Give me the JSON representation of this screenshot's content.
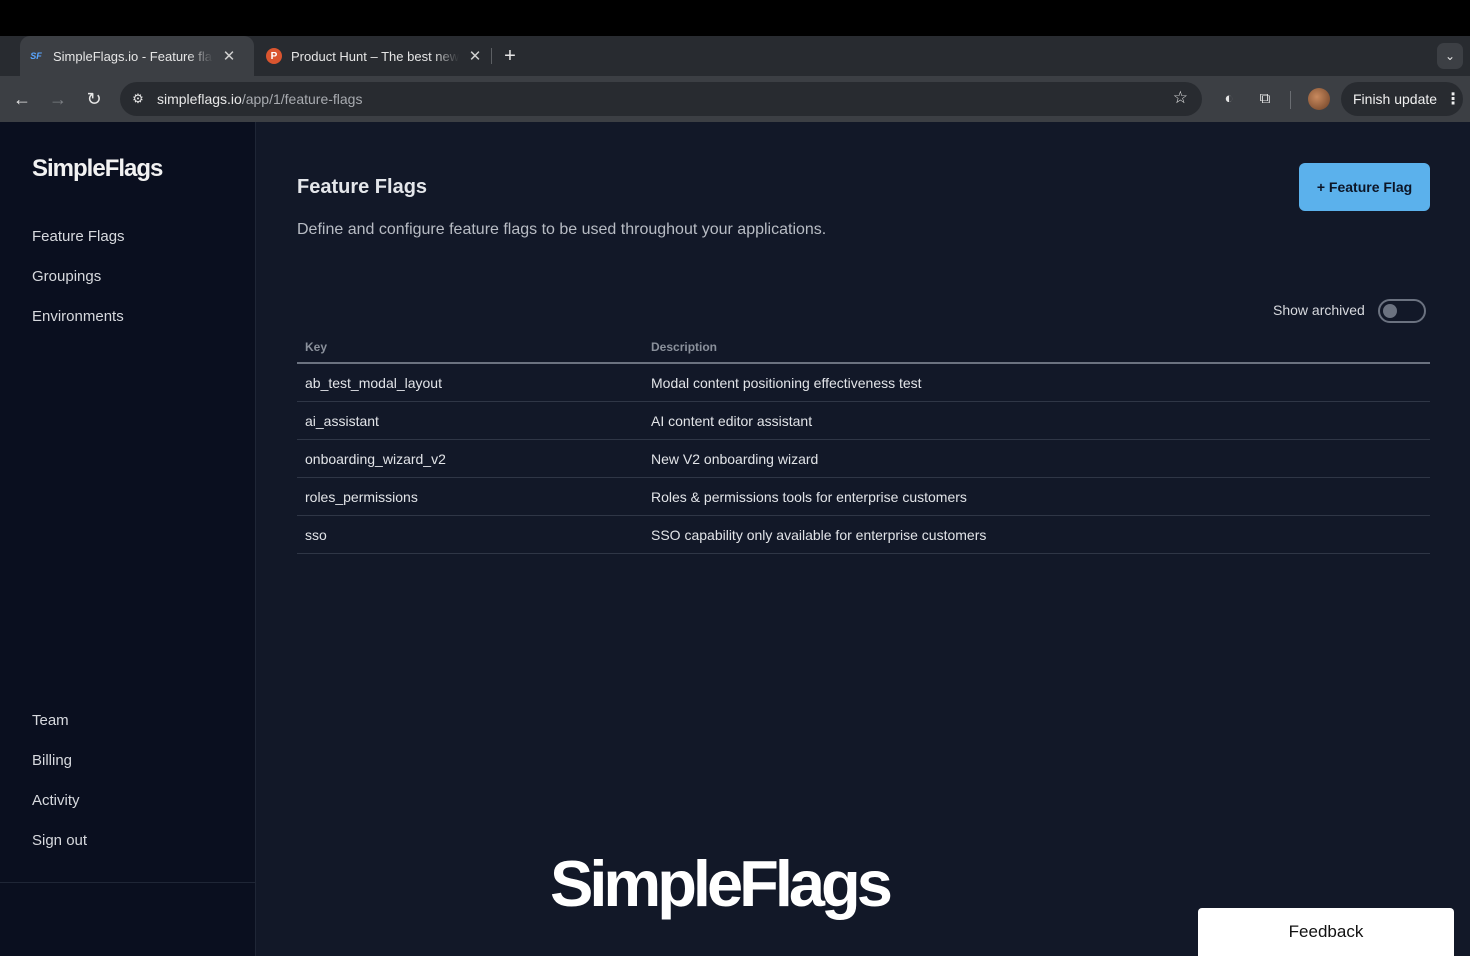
{
  "browser": {
    "tabs": [
      {
        "favicon": "SF",
        "title": "SimpleFlags.io - Feature flags",
        "active": true
      },
      {
        "favicon": "P",
        "title": "Product Hunt – The best new products",
        "active": false
      }
    ],
    "url_domain": "simpleflags.io",
    "url_path": "/app/1/feature-flags",
    "update_label": "Finish update"
  },
  "sidebar": {
    "logo": "SimpleFlags",
    "nav": [
      {
        "label": "Feature Flags"
      },
      {
        "label": "Groupings"
      },
      {
        "label": "Environments"
      }
    ],
    "bottom_nav": [
      {
        "label": "Team"
      },
      {
        "label": "Billing"
      },
      {
        "label": "Activity"
      },
      {
        "label": "Sign out"
      }
    ]
  },
  "main": {
    "title": "Feature Flags",
    "description": "Define and configure feature flags to be used throughout your applications.",
    "add_button": "+ Feature Flag",
    "show_archived_label": "Show archived",
    "show_archived": false,
    "table": {
      "columns": [
        "Key",
        "Description"
      ],
      "rows": [
        {
          "key": "ab_test_modal_layout",
          "description": "Modal content positioning effectiveness test"
        },
        {
          "key": "ai_assistant",
          "description": "AI content editor assistant"
        },
        {
          "key": "onboarding_wizard_v2",
          "description": "New V2 onboarding wizard"
        },
        {
          "key": "roles_permissions",
          "description": "Roles & permissions tools for enterprise customers"
        },
        {
          "key": "sso",
          "description": "SSO capability only available for enterprise customers"
        }
      ]
    }
  },
  "watermark": "SimpleFlags",
  "feedback_label": "Feedback",
  "colors": {
    "app_bg": "#121828",
    "sidebar_bg": "#0a0f1f",
    "accent": "#5bb1ec"
  }
}
